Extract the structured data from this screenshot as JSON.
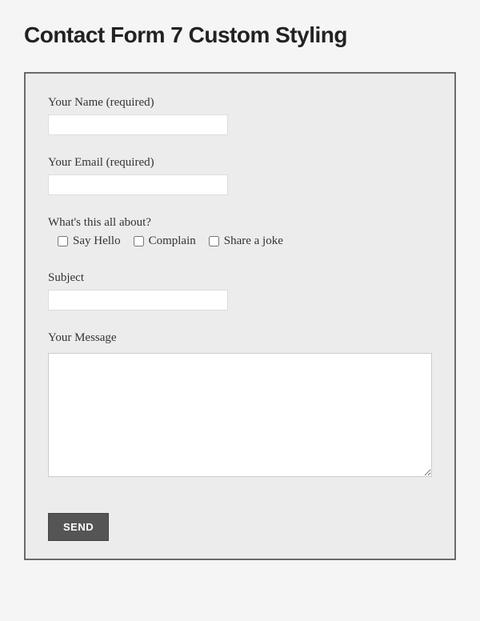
{
  "page": {
    "title": "Contact Form 7 Custom Styling"
  },
  "form": {
    "name": {
      "label": "Your Name (required)",
      "value": ""
    },
    "email": {
      "label": "Your Email (required)",
      "value": ""
    },
    "about": {
      "label": "What's this all about?",
      "options": [
        {
          "label": "Say Hello"
        },
        {
          "label": "Complain"
        },
        {
          "label": "Share a joke"
        }
      ]
    },
    "subject": {
      "label": "Subject",
      "value": ""
    },
    "message": {
      "label": "Your Message",
      "value": ""
    },
    "submit": {
      "label": "SEND"
    }
  }
}
